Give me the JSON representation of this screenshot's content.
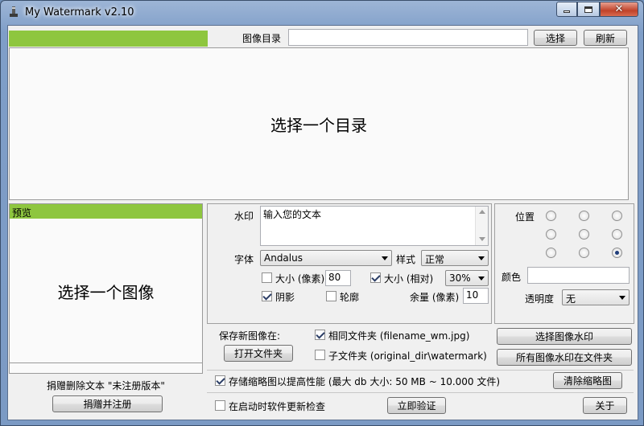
{
  "window": {
    "title": "My Watermark v2.10",
    "controls": [
      "minimize",
      "maximize",
      "close"
    ]
  },
  "top": {
    "folder_label": "图像目录",
    "folder_value": "",
    "select_button": "选择",
    "refresh_button": "刷新",
    "main_message": "选择一个目录",
    "accent_color": "#8ec63f"
  },
  "preview": {
    "header": "预览",
    "message": "选择一个图像",
    "donate_text": "捐赠删除文本 \"未注册版本\"",
    "donate_button": "捐赠并注册"
  },
  "watermark": {
    "text_label": "水印",
    "text_value": "输入您的文本",
    "font_label": "字体",
    "font_value": "Andalus",
    "style_label": "样式",
    "style_value": "正常",
    "size_px_label": "大小 (像素)",
    "size_px_value": "80",
    "size_px_checked": false,
    "size_rel_label": "大小 (相对)",
    "size_rel_value": "30%",
    "size_rel_checked": true,
    "shadow_label": "阴影",
    "shadow_checked": true,
    "outline_label": "轮廓",
    "outline_checked": false,
    "margin_label": "余量 (像素)",
    "margin_value": "10"
  },
  "position": {
    "label": "位置",
    "selected": "bottom-right",
    "color_label": "颜色",
    "color_value": "",
    "opacity_label": "透明度",
    "opacity_value": "无"
  },
  "save": {
    "save_label": "保存新图像在:",
    "open_folder_button": "打开文件夹",
    "same_folder_label": "相同文件夹 (filename_wm.jpg)",
    "same_folder_checked": true,
    "subfolder_label": "子文件夹 (original_dir\\watermark)",
    "subfolder_checked": false,
    "watermark_selected_button": "选择图像水印",
    "watermark_all_button": "所有图像水印在文件夹"
  },
  "cache": {
    "label": "存储缩略图以提高性能 (最大 db 大小: 50 MB ~ 10.000 文件)",
    "checked": true,
    "clear_button": "清除缩略图"
  },
  "update": {
    "label": "在启动时软件更新检查",
    "checked": false,
    "verify_button": "立即验证",
    "about_button": "关于"
  }
}
